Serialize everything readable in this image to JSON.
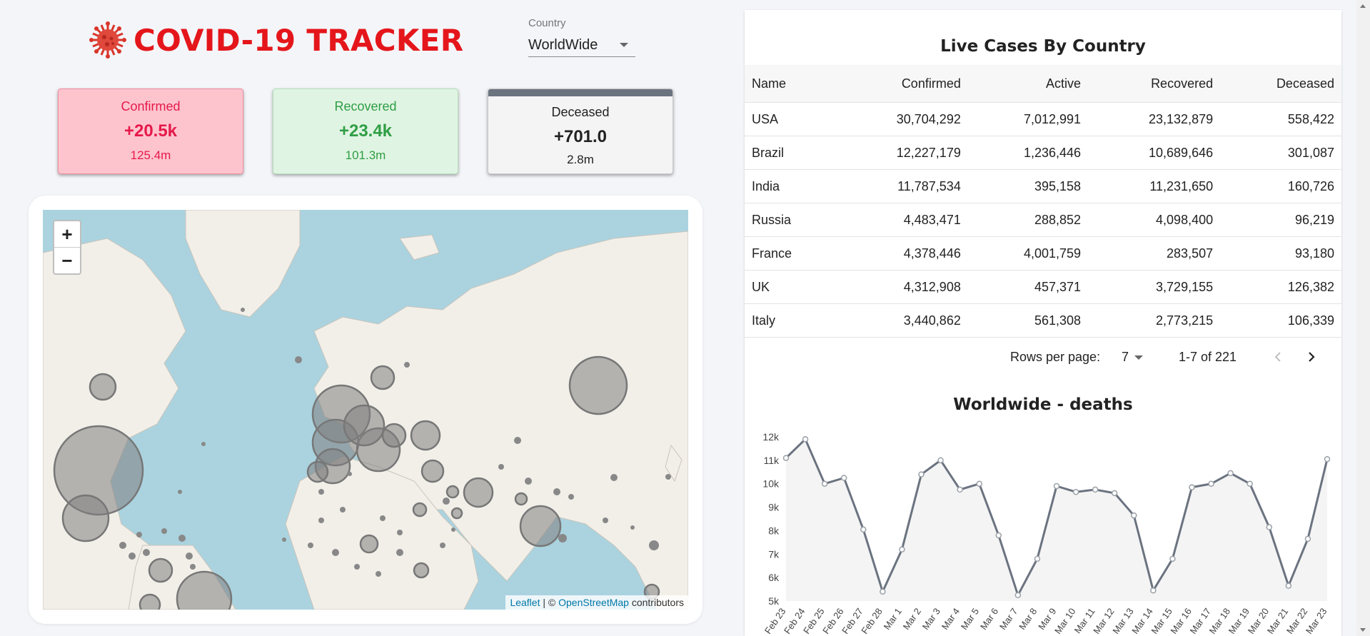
{
  "header": {
    "title": "COVID-19 TRACKER",
    "logo_icon": "virus-icon",
    "accent": "#e4161b"
  },
  "country_select": {
    "label": "Country",
    "value": "WorldWide"
  },
  "stats": {
    "confirmed": {
      "title": "Confirmed",
      "today": "+20.5k",
      "total": "125.4m",
      "color": "#e5194a"
    },
    "recovered": {
      "title": "Recovered",
      "today": "+23.4k",
      "total": "101.3m",
      "color": "#2f9e44"
    },
    "deceased": {
      "title": "Deceased",
      "today": "+701.0",
      "total": "2.8m",
      "color": "#6b7380"
    }
  },
  "map": {
    "zoom_in": "+",
    "zoom_out": "−",
    "attribution": {
      "leaflet": "Leaflet",
      "separator": "| ©",
      "osm": "OpenStreetMap",
      "suffix": "contributors"
    }
  },
  "table": {
    "title": "Live Cases By Country",
    "columns": [
      "Name",
      "Confirmed",
      "Active",
      "Recovered",
      "Deceased"
    ],
    "rows": [
      [
        "USA",
        "30,704,292",
        "7,012,991",
        "23,132,879",
        "558,422"
      ],
      [
        "Brazil",
        "12,227,179",
        "1,236,446",
        "10,689,646",
        "301,087"
      ],
      [
        "India",
        "11,787,534",
        "395,158",
        "11,231,650",
        "160,726"
      ],
      [
        "Russia",
        "4,483,471",
        "288,852",
        "4,098,400",
        "96,219"
      ],
      [
        "France",
        "4,378,446",
        "4,001,759",
        "283,507",
        "93,180"
      ],
      [
        "UK",
        "4,312,908",
        "457,371",
        "3,729,155",
        "126,382"
      ],
      [
        "Italy",
        "3,440,862",
        "561,308",
        "2,773,215",
        "106,339"
      ]
    ],
    "pagination": {
      "rows_per_page_label": "Rows per page:",
      "rows_per_page": "7",
      "range": "1-7 of 221"
    }
  },
  "chart_data": {
    "type": "area",
    "title": "Worldwide - deaths",
    "xlabel": "",
    "ylabel": "",
    "x": [
      "Feb 23",
      "Feb 24",
      "Feb 25",
      "Feb 26",
      "Feb 27",
      "Feb 28",
      "Mar 1",
      "Mar 2",
      "Mar 3",
      "Mar 4",
      "Mar 5",
      "Mar 6",
      "Mar 7",
      "Mar 8",
      "Mar 9",
      "Mar 10",
      "Mar 11",
      "Mar 12",
      "Mar 13",
      "Mar 14",
      "Mar 15",
      "Mar 16",
      "Mar 17",
      "Mar 18",
      "Mar 19",
      "Mar 20",
      "Mar 21",
      "Mar 22",
      "Mar 23"
    ],
    "values": [
      11100,
      11900,
      10000,
      10250,
      8050,
      5400,
      7200,
      10400,
      11000,
      9750,
      10000,
      7800,
      5250,
      6800,
      9900,
      9650,
      9750,
      9600,
      8650,
      5450,
      6800,
      9850,
      10000,
      10450,
      10000,
      8150,
      5650,
      7650,
      11050
    ],
    "ylim": [
      5000,
      12000
    ],
    "yticks": [
      5000,
      6000,
      7000,
      8000,
      9000,
      10000,
      11000,
      12000
    ],
    "ytick_labels": [
      "5k",
      "6k",
      "7k",
      "8k",
      "9k",
      "10k",
      "11k",
      "12k"
    ],
    "line_color": "#6b7380",
    "fill_color": "#f4f4f4",
    "grid": false
  }
}
